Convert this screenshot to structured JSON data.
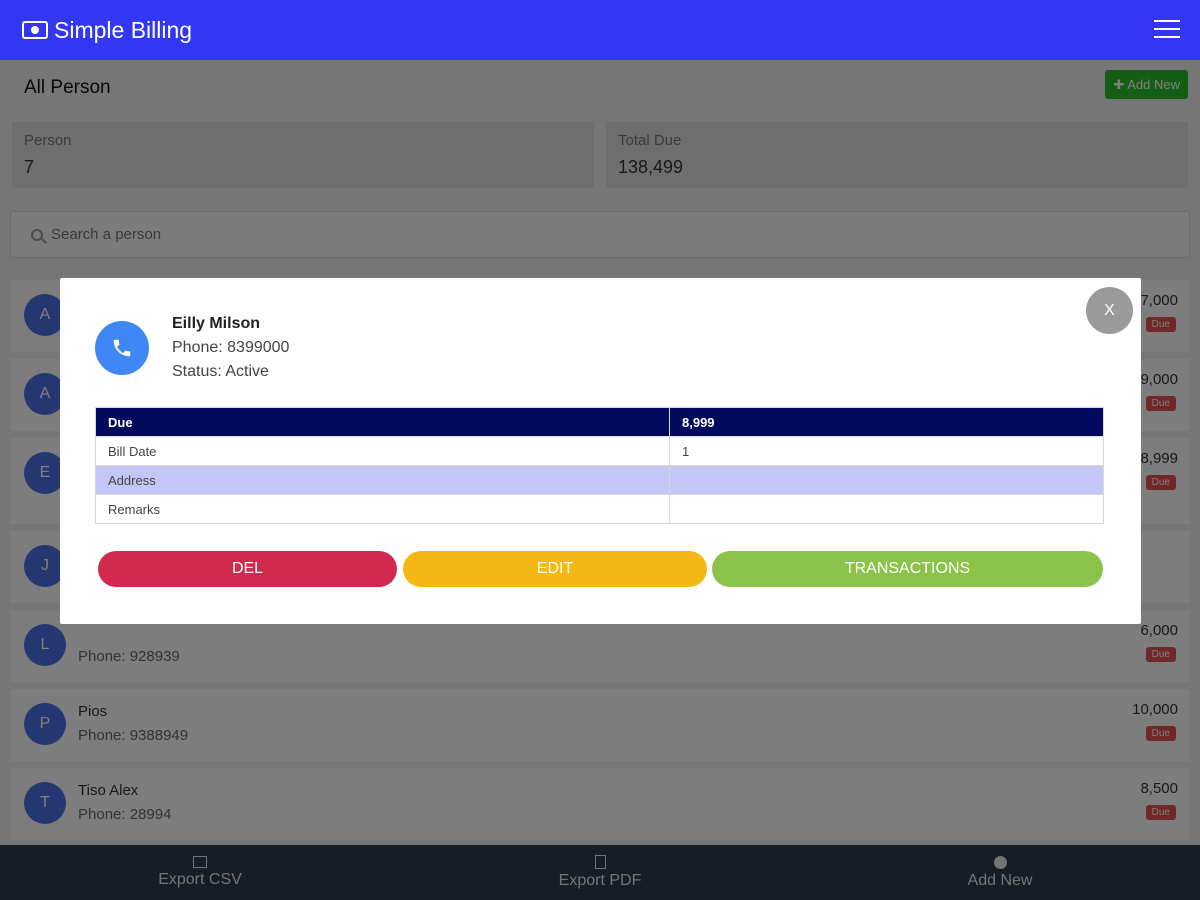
{
  "app": {
    "title": "Simple Billing"
  },
  "page": {
    "heading": "All Person",
    "add_button_label": "Add New"
  },
  "stats": {
    "person": {
      "label": "Person",
      "value": "7"
    },
    "total_due": {
      "label": "Total Due",
      "value": "138,499"
    }
  },
  "search": {
    "placeholder": "Search a person"
  },
  "persons": [
    {
      "initial": "A",
      "name": "",
      "phone": "",
      "amount": "7,000",
      "badge": "Due"
    },
    {
      "initial": "A",
      "name": "",
      "phone": "",
      "amount": "9,000",
      "badge": "Due"
    },
    {
      "initial": "E",
      "name": "",
      "phone": "",
      "amount": "8,999",
      "badge": "Due"
    },
    {
      "initial": "J",
      "name": "",
      "phone": "",
      "amount": "",
      "badge": ""
    },
    {
      "initial": "L",
      "name": "",
      "phone": "Phone: 928939",
      "amount": "6,000",
      "badge": "Due"
    },
    {
      "initial": "P",
      "name": "Pios",
      "phone": "Phone: 9388949",
      "amount": "10,000",
      "badge": "Due"
    },
    {
      "initial": "T",
      "name": "Tiso Alex",
      "phone": "Phone: 28994",
      "amount": "8,500",
      "badge": "Due"
    }
  ],
  "bottom_nav": {
    "export_csv": "Export CSV",
    "export_pdf": "Export PDF",
    "add_new": "Add New"
  },
  "modal": {
    "close_label": "X",
    "name": "Eilly Milson",
    "phone_line": "Phone: 8399000",
    "status_line": "Status: Active",
    "table": [
      {
        "label": "Due",
        "value": "8,999"
      },
      {
        "label": "Bill Date",
        "value": "1"
      },
      {
        "label": "Address",
        "value": ""
      },
      {
        "label": "Remarks",
        "value": ""
      }
    ],
    "buttons": {
      "del": "DEL",
      "edit": "EDIT",
      "transactions": "TRANSACTIONS"
    }
  },
  "colors": {
    "appbar": "#3336f5",
    "table_header": "#020a5e",
    "del": "#d12a4e",
    "edit": "#f5b714",
    "transactions": "#8bc34a",
    "avatar": "#4a6ee0"
  }
}
